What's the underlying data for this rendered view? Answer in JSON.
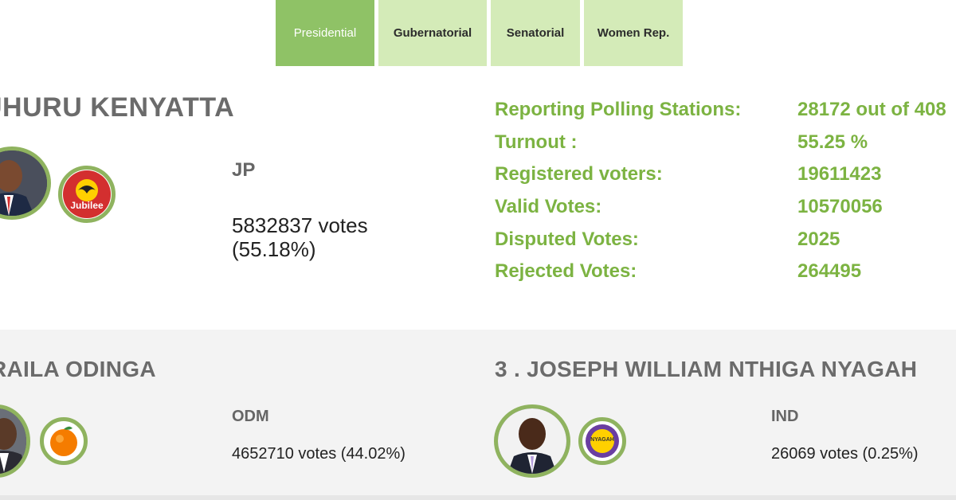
{
  "tabs": [
    "Presidential",
    "Gubernatorial",
    "Senatorial",
    "Women Rep."
  ],
  "active_tab": "Presidential",
  "leader": {
    "name": "UHURU KENYATTA",
    "party": "JP",
    "party_logo_text": "Jubilee",
    "votes": "5832837 votes",
    "percent": "(55.18%)"
  },
  "stats": [
    {
      "label": "Reporting Polling Stations:",
      "value": "28172 out of 408"
    },
    {
      "label": "Turnout :",
      "value": "55.25 %"
    },
    {
      "label": "Registered voters:",
      "value": "19611423"
    },
    {
      "label": "Valid Votes:",
      "value": "10570056"
    },
    {
      "label": "Disputed Votes:",
      "value": "2025"
    },
    {
      "label": "Rejected Votes:",
      "value": "264495"
    }
  ],
  "candidates": [
    {
      "name": "RAILA ODINGA",
      "party": "ODM",
      "votes": "4652710 votes (44.02%)"
    },
    {
      "name": "3 . JOSEPH WILLIAM NTHIGA NYAGAH",
      "party": "IND",
      "party_logo_text": "NYAGAH",
      "votes": "26069 votes (0.25%)"
    }
  ],
  "colors": {
    "accent_green": "#7cb342",
    "tab_active": "#8fc266",
    "tab_inactive": "#d4ebb8",
    "avatar_border": "#8fb35f",
    "name_gray": "#6b6b6b"
  }
}
